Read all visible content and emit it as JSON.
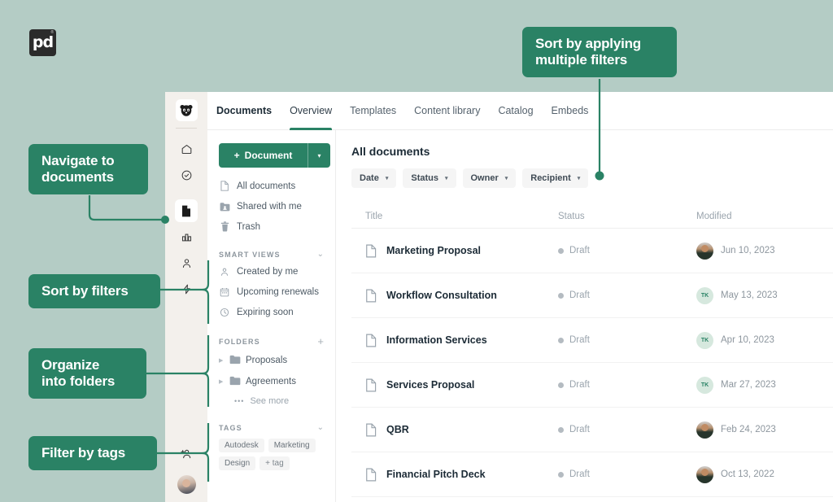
{
  "brand": {
    "name": "pd",
    "trademark": "®"
  },
  "callouts": [
    {
      "id": "navigate",
      "text": "Navigate to documents"
    },
    {
      "id": "sort-filters",
      "text": "Sort by filters"
    },
    {
      "id": "folders",
      "text": "Organize into folders"
    },
    {
      "id": "tags",
      "text": "Filter by tags"
    },
    {
      "id": "multi-filters",
      "text": "Sort by applying multiple filters"
    }
  ],
  "callout_lines": {
    "navigate_1": "Navigate to",
    "navigate_2": "documents",
    "sort_filters": "Sort by filters",
    "folders_1": "Organize",
    "folders_2": "into folders",
    "tags": "Filter by tags",
    "multi_1": "Sort by applying",
    "multi_2": "multiple filters"
  },
  "rail": {
    "logo": "panda-logo-icon",
    "items": [
      {
        "icon": "home-icon",
        "active": false
      },
      {
        "icon": "check-circle-icon",
        "active": false
      },
      {
        "icon": "document-icon",
        "active": true
      },
      {
        "icon": "chart-bar-icon",
        "active": false
      },
      {
        "icon": "person-icon",
        "active": false
      },
      {
        "icon": "lightning-icon",
        "active": false
      }
    ],
    "bottom": [
      {
        "icon": "add-person-icon"
      },
      {
        "icon": "user-avatar"
      }
    ]
  },
  "tabs": [
    {
      "label": "Documents",
      "style": "title"
    },
    {
      "label": "Overview",
      "style": "active"
    },
    {
      "label": "Templates",
      "style": "normal"
    },
    {
      "label": "Content library",
      "style": "normal"
    },
    {
      "label": "Catalog",
      "style": "normal"
    },
    {
      "label": "Embeds",
      "style": "normal"
    }
  ],
  "sidebar": {
    "new_button": {
      "label": "Document",
      "plus": "+",
      "caret": "▾"
    },
    "nav_items": [
      {
        "label": "All documents",
        "icon": "file-icon"
      },
      {
        "label": "Shared with me",
        "icon": "shared-icon"
      },
      {
        "label": "Trash",
        "icon": "trash-icon"
      }
    ],
    "smart_views": {
      "title": "SMART VIEWS",
      "collapse": "⌄",
      "items": [
        {
          "label": "Created by me",
          "icon": "person-icon"
        },
        {
          "label": "Upcoming renewals",
          "icon": "calendar-icon"
        },
        {
          "label": "Expiring soon",
          "icon": "clock-icon"
        }
      ]
    },
    "folders": {
      "title": "FOLDERS",
      "add": "+",
      "items": [
        {
          "label": "Proposals",
          "icon": "folder-icon",
          "caret": "▶"
        },
        {
          "label": "Agreements",
          "icon": "folder-icon",
          "caret": "▶"
        }
      ],
      "see_more": {
        "label": "See more",
        "icon": "ellipsis-icon"
      }
    },
    "tags": {
      "title": "TAGS",
      "collapse": "⌄",
      "items": [
        "Autodesk",
        "Marketing",
        "Design"
      ],
      "add_label": "+ tag"
    }
  },
  "main": {
    "title": "All documents",
    "filters": [
      {
        "label": "Date",
        "caret": "▾"
      },
      {
        "label": "Status",
        "caret": "▾"
      },
      {
        "label": "Owner",
        "caret": "▾"
      },
      {
        "label": "Recipient",
        "caret": "▾"
      }
    ],
    "columns": {
      "title": "Title",
      "status": "Status",
      "modified": "Modified"
    },
    "rows": [
      {
        "title": "Marketing Proposal",
        "status": "Draft",
        "modified": "Jun 10, 2023",
        "avatar_type": "photo",
        "avatar_text": ""
      },
      {
        "title": "Workflow Consultation",
        "status": "Draft",
        "modified": "May 13, 2023",
        "avatar_type": "initials",
        "avatar_text": "TK"
      },
      {
        "title": "Information Services",
        "status": "Draft",
        "modified": "Apr 10, 2023",
        "avatar_type": "initials",
        "avatar_text": "TK"
      },
      {
        "title": "Services Proposal",
        "status": "Draft",
        "modified": "Mar 27, 2023",
        "avatar_type": "initials",
        "avatar_text": "TK"
      },
      {
        "title": "QBR",
        "status": "Draft",
        "modified": "Feb 24, 2023",
        "avatar_type": "photo",
        "avatar_text": ""
      },
      {
        "title": "Financial Pitch Deck",
        "status": "Draft",
        "modified": "Oct 13, 2022",
        "avatar_type": "photo",
        "avatar_text": ""
      }
    ]
  },
  "colors": {
    "page_background": "#b4ccc5",
    "accent_green": "#2a8265",
    "rail_background": "#f3f0ec",
    "panel_white": "#ffffff",
    "avatar_green": "#d6e8de",
    "status_dot": "#b4bbc1"
  }
}
